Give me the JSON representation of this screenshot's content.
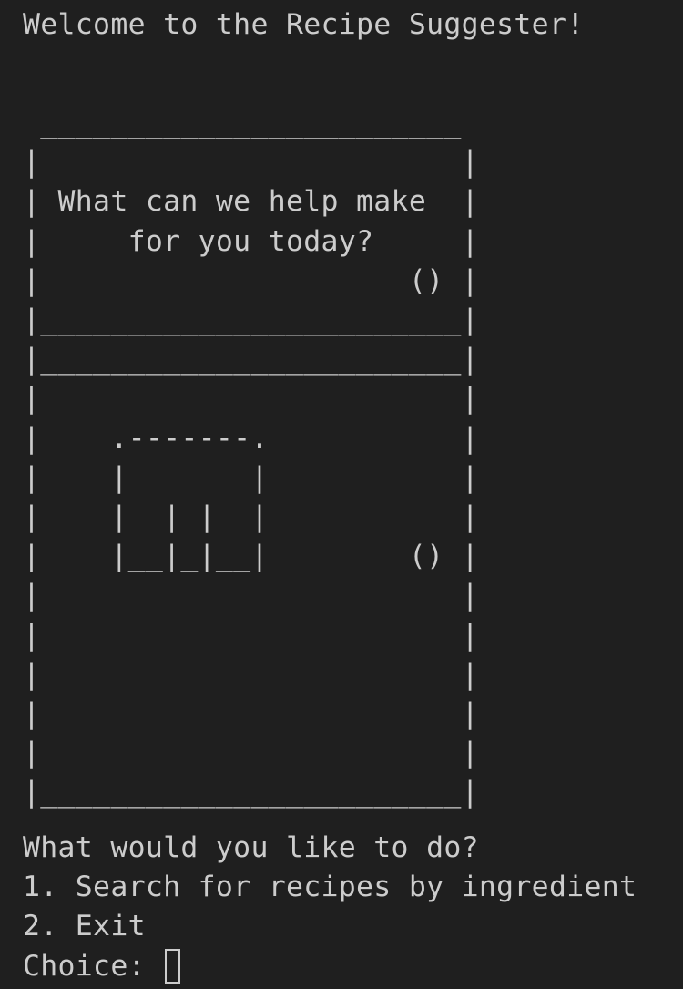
{
  "terminal": {
    "welcome": "Welcome to the Recipe Suggester!",
    "fridge_art": " ________________________\n|                        |\n| What can we help make  |\n|     for you today?     |\n|                     () |\n|________________________|\n|________________________|\n|                        |\n|    .-------.           |\n|    |       |           |\n|    |  | |  |           |\n|    |__|_|__|        () |\n|                        |\n|                        |\n|                        |\n|                        |\n|                        |\n|________________________|",
    "menu_prompt": "What would you like to do?",
    "option_1": "1. Search for recipes by ingredient",
    "option_2": "2. Exit",
    "choice_label": "Choice: ",
    "choice_value": ""
  }
}
